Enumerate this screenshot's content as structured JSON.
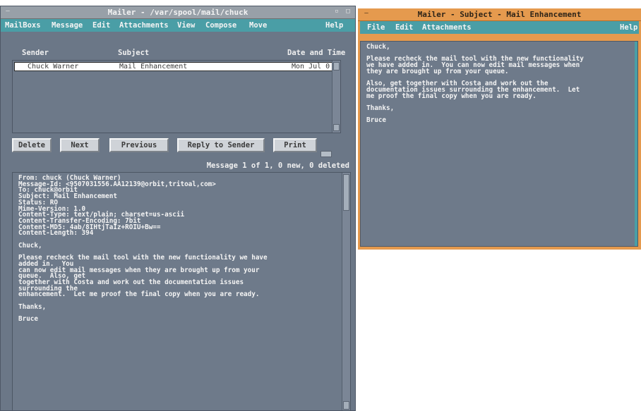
{
  "main_window": {
    "title": "Mailer - /var/spool/mail/chuck",
    "menu": [
      "MailBoxs",
      "Message",
      "Edit",
      "Attachments",
      "View",
      "Compose",
      "Move",
      "Help"
    ],
    "list_headers": {
      "sender": "Sender",
      "subject": "Subject",
      "date": "Date and Time"
    },
    "messages": [
      {
        "sender": "Chuck Warner",
        "subject": "Mail Enhancement",
        "date": "Mon Jul 0"
      }
    ],
    "buttons": {
      "delete": "Delete",
      "next": "Next",
      "previous": "Previous",
      "reply": "Reply to Sender",
      "print": "Print"
    },
    "status": "Message 1 of 1, 0 new, 0 deleted",
    "message_body": "From: chuck (Chuck Warner)\nMessage-Id: <9507031556.AA12139@orbit,tritoal,com>\nTo: chuck@orbit\nSubject: Mail Enhancement\nStatus: RO\nMime-Version: 1.0\nContent-Type: text/plain; charset=us-ascii\nContent-Transfer-Encoding: 7bit\nContent-MD5: 4ab/8IHtjTaIz+ROIU+Bw==\nContent-Length: 394\n\nChuck,\n\nPlease recheck the mail tool with the new functionality we have\nadded in.  You\ncan now edit mail messages when they are brought up from your\nqueue.  Also, get\ntogether with Costa and work out the documentation issues\nsurrounding the\nenhancement.  Let me proof the final copy when you are ready.\n\nThanks,\n\nBruce"
  },
  "sub_window": {
    "title": "Mailer - Subject - Mail Enhancement",
    "menu": [
      "File",
      "Edit",
      "Attachments",
      "Help"
    ],
    "body": "Chuck,\n\nPlease recheck the mail tool with the new functionality\nwe have added in.  You can now edit mail messages when\nthey are brought up from your queue.\n\nAlso, get together with Costa and work out the\ndocumentation issues surrounding the enhancement.  Let\nme proof the final copy when you are ready.\n\nThanks,\n\nBruce"
  },
  "colors": {
    "window_bg": "#6b7787",
    "menubar": "#4a9ea6",
    "active_frame": "#e59a4e",
    "inactive_title": "#98a0a8"
  }
}
